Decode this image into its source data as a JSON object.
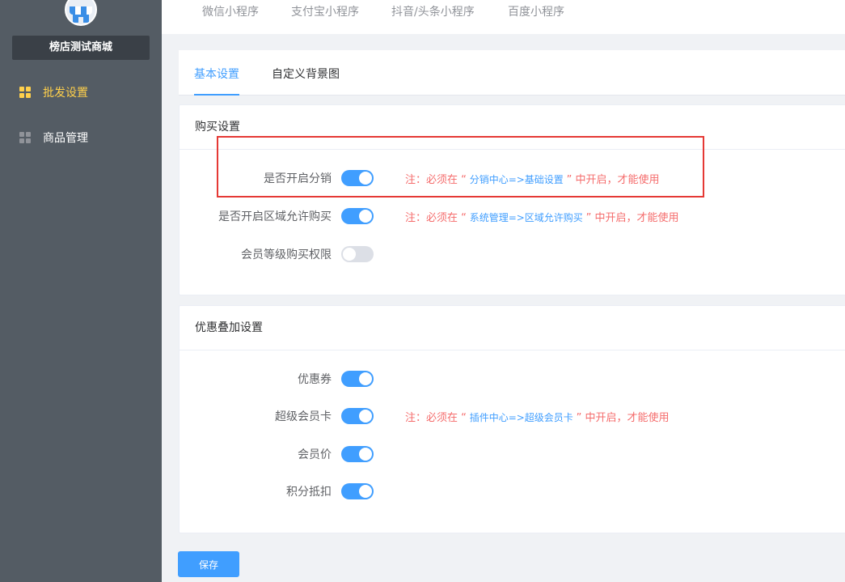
{
  "sidebar": {
    "shop_name": "榜店测试商城",
    "items": [
      {
        "label": "批发设置",
        "active": true
      },
      {
        "label": "商品管理",
        "active": false
      }
    ]
  },
  "top_tabs": [
    "微信小程序",
    "支付宝小程序",
    "抖音/头条小程序",
    "百度小程序"
  ],
  "inner_tabs": [
    {
      "label": "基本设置",
      "active": true
    },
    {
      "label": "自定义背景图",
      "active": false
    }
  ],
  "purchase_settings": {
    "title": "购买设置",
    "rows": [
      {
        "label": "是否开启分销",
        "enabled": true,
        "note_prefix": "注：必须在 “",
        "note_link": " 分销中心=>基础设置 ",
        "note_suffix": "” 中开启，才能使用"
      },
      {
        "label": "是否开启区域允许购买",
        "enabled": true,
        "note_prefix": "注：必须在 “",
        "note_link": " 系统管理=>区域允许购买 ",
        "note_suffix": "” 中开启，才能使用"
      },
      {
        "label": "会员等级购买权限",
        "enabled": false
      }
    ]
  },
  "discount_settings": {
    "title": "优惠叠加设置",
    "rows": [
      {
        "label": "优惠券",
        "enabled": true
      },
      {
        "label": "超级会员卡",
        "enabled": true,
        "note_prefix": "注：必须在 “",
        "note_link": " 插件中心=>超级会员卡 ",
        "note_suffix": "” 中开启，才能使用"
      },
      {
        "label": "会员价",
        "enabled": true
      },
      {
        "label": "积分抵扣",
        "enabled": true
      }
    ]
  },
  "save_label": "保存",
  "colors": {
    "sidebar_bg": "#545c64",
    "active_menu": "#ffd04b",
    "primary": "#409eff",
    "note_red": "#f56c6c",
    "highlight": "#e53935"
  }
}
